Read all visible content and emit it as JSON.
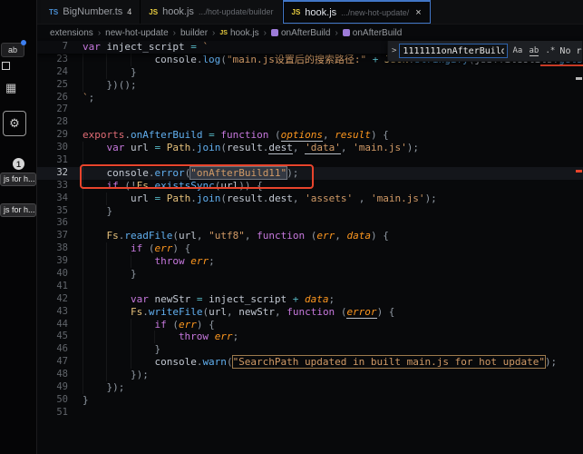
{
  "palette": {
    "keyword": "#c678dd",
    "string": "#d19a66",
    "function": "#61afef",
    "class": "#e5c07b",
    "param": "#fd971f",
    "variable": "#c2c8d2",
    "exports": "#e06c75",
    "punct": "#9099a3",
    "operator": "#56b6c2",
    "annotation": "#e8442c",
    "accent_blue": "#4176c6",
    "js_icon": "#e8cc3f",
    "ts_icon": "#4a8fd4",
    "symbol_icon": "#9d7bd8",
    "dot_blue": "#3d7ff0"
  },
  "left_strip": {
    "ab_chip": "ab",
    "grid_icon": "▦",
    "gear_icon": "⚙",
    "badge": "1",
    "pill_top": "js for h...",
    "pill_bottom": "js for h..."
  },
  "tabs": [
    {
      "icon_text": "TS",
      "file": "BigNumber.ts",
      "badge": "4"
    },
    {
      "icon_text": "JS",
      "file": "hook.js",
      "desc": ".../hot-update/builder"
    },
    {
      "icon_text": "JS",
      "file": "hook.js",
      "desc": ".../new-hot-update/",
      "close": "×"
    }
  ],
  "breadcrumb": {
    "sep": "›",
    "items": [
      "extensions",
      "new-hot-update",
      "builder",
      "hook.js",
      "onAfterBuild",
      "onAfterBuild"
    ]
  },
  "find": {
    "chevron": ">",
    "value": "1111111onAfterBuild",
    "match_case": "Aa",
    "whole_word": "ab",
    "regex": ".*",
    "results": "No r"
  },
  "editor": {
    "sticky": {
      "n": "7",
      "ind": 0,
      "tk": [
        {
          "t": "var",
          "c": "k"
        },
        {
          "t": " inject_script ",
          "c": "v"
        },
        {
          "t": "=",
          "c": "op"
        },
        {
          "t": " `",
          "c": "s"
        }
      ]
    },
    "lines": [
      {
        "n": "23",
        "ind": 12,
        "tk": [
          {
            "t": "console",
            "c": "v"
          },
          {
            "t": ".",
            "c": "p"
          },
          {
            "t": "log",
            "c": "f"
          },
          {
            "t": "(",
            "c": "p"
          },
          {
            "t": "\"main.js设置后的搜索路径:\"",
            "c": "s"
          },
          {
            "t": " ",
            "c": "v"
          },
          {
            "t": "+",
            "c": "op"
          },
          {
            "t": " ",
            "c": "v"
          },
          {
            "t": "JSON",
            "c": "o"
          },
          {
            "t": ".",
            "c": "p"
          },
          {
            "t": "stringify",
            "c": "f"
          },
          {
            "t": "(",
            "c": "p"
          },
          {
            "t": "jsb",
            "c": "v"
          },
          {
            "t": ".",
            "c": "p"
          },
          {
            "t": "fileUtils",
            "c": "v"
          },
          {
            "t": ".",
            "c": "p"
          },
          {
            "t": "getSearchPaths",
            "c": "f"
          },
          {
            "t": "()));",
            "c": "p"
          }
        ]
      },
      {
        "n": "24",
        "ind": 8,
        "tk": [
          {
            "t": "}",
            "c": "p"
          }
        ]
      },
      {
        "n": "25",
        "ind": 4,
        "tk": [
          {
            "t": "})();",
            "c": "p"
          }
        ]
      },
      {
        "n": "26",
        "ind": 0,
        "tk": [
          {
            "t": "`",
            "c": "s"
          },
          {
            "t": ";",
            "c": "p"
          }
        ]
      },
      {
        "n": "27",
        "ind": 0,
        "tk": []
      },
      {
        "n": "28",
        "ind": 0,
        "tk": []
      },
      {
        "n": "29",
        "ind": 0,
        "tk": [
          {
            "t": "exports",
            "c": "e"
          },
          {
            "t": ".",
            "c": "p"
          },
          {
            "t": "onAfterBuild",
            "c": "f"
          },
          {
            "t": " ",
            "c": "v"
          },
          {
            "t": "=",
            "c": "op"
          },
          {
            "t": " ",
            "c": "v"
          },
          {
            "t": "function",
            "c": "k"
          },
          {
            "t": " ",
            "c": "v"
          },
          {
            "t": "(",
            "c": "p"
          },
          {
            "t": "options",
            "c": "pr",
            "u": true
          },
          {
            "t": ", ",
            "c": "p"
          },
          {
            "t": "result",
            "c": "pr"
          },
          {
            "t": ") {",
            "c": "p"
          }
        ]
      },
      {
        "n": "30",
        "ind": 4,
        "tk": [
          {
            "t": "var",
            "c": "k"
          },
          {
            "t": " url ",
            "c": "v"
          },
          {
            "t": "=",
            "c": "op"
          },
          {
            "t": " ",
            "c": "v"
          },
          {
            "t": "Path",
            "c": "o"
          },
          {
            "t": ".",
            "c": "p"
          },
          {
            "t": "join",
            "c": "f"
          },
          {
            "t": "(",
            "c": "p"
          },
          {
            "t": "result",
            "c": "v"
          },
          {
            "t": ".",
            "c": "p"
          },
          {
            "t": "dest",
            "c": "v",
            "u": true
          },
          {
            "t": ", ",
            "c": "p"
          },
          {
            "t": "'data'",
            "c": "s",
            "u": true
          },
          {
            "t": ", ",
            "c": "p"
          },
          {
            "t": "'main.js'",
            "c": "s"
          },
          {
            "t": ");",
            "c": "p"
          }
        ]
      },
      {
        "n": "31",
        "ind": 4,
        "tk": []
      },
      {
        "n": "32",
        "ind": 4,
        "cur": true,
        "tk": [
          {
            "t": "console",
            "c": "v"
          },
          {
            "t": ".",
            "c": "p"
          },
          {
            "t": "error",
            "c": "f"
          },
          {
            "t": "(",
            "c": "p"
          },
          {
            "t": "\"onAfterBuild11\"",
            "c": "s",
            "h": "hl"
          },
          {
            "t": ");",
            "c": "p"
          }
        ]
      },
      {
        "n": "33",
        "ind": 4,
        "tk": [
          {
            "t": "if",
            "c": "k"
          },
          {
            "t": " ",
            "c": "v"
          },
          {
            "t": "(!",
            "c": "p"
          },
          {
            "t": "Fs",
            "c": "o"
          },
          {
            "t": ".",
            "c": "p"
          },
          {
            "t": "existsSync",
            "c": "f"
          },
          {
            "t": "(",
            "c": "p"
          },
          {
            "t": "url",
            "c": "v"
          },
          {
            "t": ")) {",
            "c": "p"
          }
        ]
      },
      {
        "n": "34",
        "ind": 8,
        "tk": [
          {
            "t": "url ",
            "c": "v"
          },
          {
            "t": "=",
            "c": "op"
          },
          {
            "t": " ",
            "c": "v"
          },
          {
            "t": "Path",
            "c": "o"
          },
          {
            "t": ".",
            "c": "p"
          },
          {
            "t": "join",
            "c": "f"
          },
          {
            "t": "(",
            "c": "p"
          },
          {
            "t": "result",
            "c": "v"
          },
          {
            "t": ".",
            "c": "p"
          },
          {
            "t": "dest",
            "c": "v"
          },
          {
            "t": ", ",
            "c": "p"
          },
          {
            "t": "'assets'",
            "c": "s"
          },
          {
            "t": " ",
            "c": "v"
          },
          {
            "t": ", ",
            "c": "p"
          },
          {
            "t": "'main.js'",
            "c": "s"
          },
          {
            "t": ");",
            "c": "p"
          }
        ]
      },
      {
        "n": "35",
        "ind": 4,
        "tk": [
          {
            "t": "}",
            "c": "p"
          }
        ]
      },
      {
        "n": "36",
        "ind": 4,
        "tk": []
      },
      {
        "n": "37",
        "ind": 4,
        "tk": [
          {
            "t": "Fs",
            "c": "o"
          },
          {
            "t": ".",
            "c": "p"
          },
          {
            "t": "readFile",
            "c": "f"
          },
          {
            "t": "(",
            "c": "p"
          },
          {
            "t": "url",
            "c": "v"
          },
          {
            "t": ", ",
            "c": "p"
          },
          {
            "t": "\"utf8\"",
            "c": "s"
          },
          {
            "t": ", ",
            "c": "p"
          },
          {
            "t": "function",
            "c": "k"
          },
          {
            "t": " ",
            "c": "v"
          },
          {
            "t": "(",
            "c": "p"
          },
          {
            "t": "err",
            "c": "pr"
          },
          {
            "t": ", ",
            "c": "p"
          },
          {
            "t": "data",
            "c": "pr"
          },
          {
            "t": ") {",
            "c": "p"
          }
        ]
      },
      {
        "n": "38",
        "ind": 8,
        "tk": [
          {
            "t": "if",
            "c": "k"
          },
          {
            "t": " ",
            "c": "v"
          },
          {
            "t": "(",
            "c": "p"
          },
          {
            "t": "err",
            "c": "pr"
          },
          {
            "t": ") {",
            "c": "p"
          }
        ]
      },
      {
        "n": "39",
        "ind": 12,
        "tk": [
          {
            "t": "throw",
            "c": "k"
          },
          {
            "t": " ",
            "c": "v"
          },
          {
            "t": "err",
            "c": "pr"
          },
          {
            "t": ";",
            "c": "p"
          }
        ]
      },
      {
        "n": "40",
        "ind": 8,
        "tk": [
          {
            "t": "}",
            "c": "p"
          }
        ]
      },
      {
        "n": "41",
        "ind": 8,
        "tk": []
      },
      {
        "n": "42",
        "ind": 8,
        "tk": [
          {
            "t": "var",
            "c": "k"
          },
          {
            "t": " newStr ",
            "c": "v"
          },
          {
            "t": "=",
            "c": "op"
          },
          {
            "t": " inject_script ",
            "c": "v"
          },
          {
            "t": "+",
            "c": "op"
          },
          {
            "t": " ",
            "c": "v"
          },
          {
            "t": "data",
            "c": "pr"
          },
          {
            "t": ";",
            "c": "p"
          }
        ]
      },
      {
        "n": "43",
        "ind": 8,
        "tk": [
          {
            "t": "Fs",
            "c": "o"
          },
          {
            "t": ".",
            "c": "p"
          },
          {
            "t": "writeFile",
            "c": "f"
          },
          {
            "t": "(",
            "c": "p"
          },
          {
            "t": "url",
            "c": "v"
          },
          {
            "t": ", ",
            "c": "p"
          },
          {
            "t": "newStr",
            "c": "v"
          },
          {
            "t": ", ",
            "c": "p"
          },
          {
            "t": "function",
            "c": "k"
          },
          {
            "t": " ",
            "c": "v"
          },
          {
            "t": "(",
            "c": "p"
          },
          {
            "t": "error",
            "c": "pr",
            "u": true
          },
          {
            "t": ") {",
            "c": "p"
          }
        ]
      },
      {
        "n": "44",
        "ind": 12,
        "tk": [
          {
            "t": "if",
            "c": "k"
          },
          {
            "t": " ",
            "c": "v"
          },
          {
            "t": "(",
            "c": "p"
          },
          {
            "t": "err",
            "c": "pr"
          },
          {
            "t": ") {",
            "c": "p"
          }
        ]
      },
      {
        "n": "45",
        "ind": 16,
        "tk": [
          {
            "t": "throw",
            "c": "k"
          },
          {
            "t": " ",
            "c": "v"
          },
          {
            "t": "err",
            "c": "pr"
          },
          {
            "t": ";",
            "c": "p"
          }
        ]
      },
      {
        "n": "46",
        "ind": 12,
        "tk": [
          {
            "t": "}",
            "c": "p"
          }
        ]
      },
      {
        "n": "47",
        "ind": 12,
        "tk": [
          {
            "t": "console",
            "c": "v"
          },
          {
            "t": ".",
            "c": "p"
          },
          {
            "t": "warn",
            "c": "f"
          },
          {
            "t": "(",
            "c": "p"
          },
          {
            "t": "\"SearchPath updated in built main.js for hot update\"",
            "c": "s",
            "h": "hl2"
          },
          {
            "t": ");",
            "c": "p"
          }
        ]
      },
      {
        "n": "48",
        "ind": 8,
        "tk": [
          {
            "t": "});",
            "c": "p"
          }
        ]
      },
      {
        "n": "49",
        "ind": 4,
        "tk": [
          {
            "t": "});",
            "c": "p"
          }
        ]
      },
      {
        "n": "50",
        "ind": 0,
        "tk": [
          {
            "t": "}",
            "c": "p"
          }
        ]
      },
      {
        "n": "51",
        "ind": 0,
        "tk": []
      }
    ]
  },
  "annotation": {
    "color": "#e8442c"
  }
}
